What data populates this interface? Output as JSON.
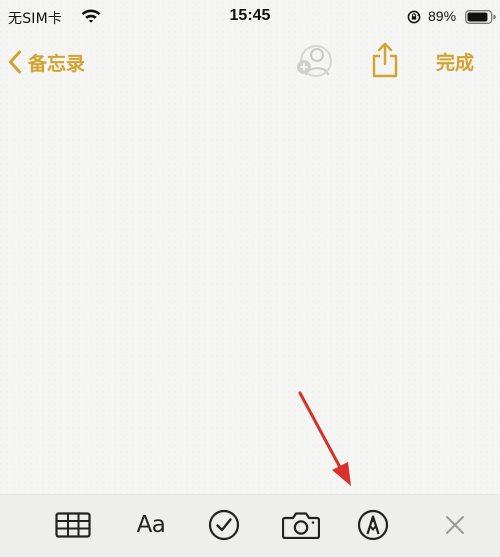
{
  "status_bar": {
    "carrier": "无SIM卡",
    "time": "15:45",
    "battery_percent": "89%",
    "battery_level": 0.89
  },
  "nav": {
    "back_label": "备忘录",
    "done_label": "完成"
  },
  "toolbar": {
    "format_label": "Aa"
  },
  "colors": {
    "accent": "#d4a22e",
    "annotation_arrow": "#d9302a",
    "icon": "#222222"
  },
  "icons": {
    "status": [
      "wifi-icon",
      "lock-rotation-icon",
      "battery-icon"
    ],
    "nav": [
      "back-chevron-icon",
      "add-people-icon",
      "share-icon"
    ],
    "toolbar": [
      "table-icon",
      "format-text-icon",
      "checklist-icon",
      "camera-icon",
      "markup-pen-icon",
      "close-icon"
    ]
  }
}
